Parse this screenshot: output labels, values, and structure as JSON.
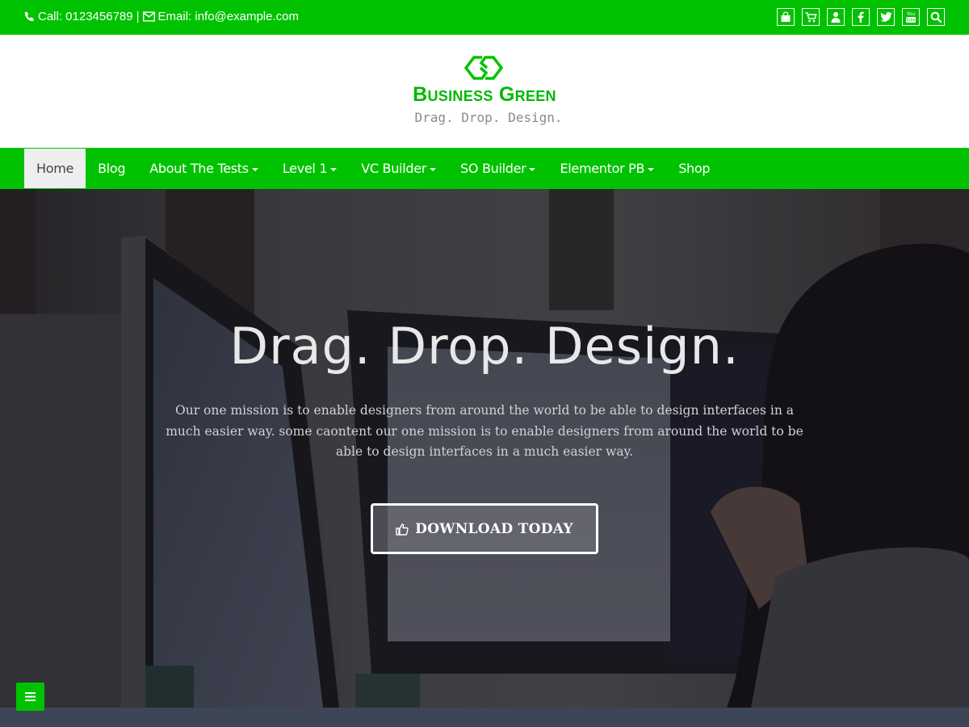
{
  "topbar": {
    "phone_icon": "phone-icon",
    "phone_text": "Call: 0123456789",
    "separator": "|",
    "email_icon": "envelope-icon",
    "email_text": "Email: info@example.com",
    "social_icons": [
      "shopping-bag-icon",
      "cart-icon",
      "user-icon",
      "facebook-icon",
      "twitter-icon",
      "youtube-icon",
      "search-icon"
    ]
  },
  "header": {
    "logo_icon": "business-green-logo-icon",
    "brand_name": "Business Green",
    "tagline": "Drag. Drop. Design."
  },
  "nav": {
    "items": [
      {
        "label": "Home",
        "active": true,
        "dropdown": false
      },
      {
        "label": "Blog",
        "active": false,
        "dropdown": false
      },
      {
        "label": "About The Tests",
        "active": false,
        "dropdown": true
      },
      {
        "label": "Level 1",
        "active": false,
        "dropdown": true
      },
      {
        "label": "VC Builder",
        "active": false,
        "dropdown": true
      },
      {
        "label": "SO Builder",
        "active": false,
        "dropdown": true
      },
      {
        "label": "Elementor PB",
        "active": false,
        "dropdown": true
      },
      {
        "label": "Shop",
        "active": false,
        "dropdown": false
      }
    ]
  },
  "hero": {
    "title": "Drag. Drop. Design.",
    "text": "Our one mission is to enable designers from around the world to be able to design interfaces in a much easier way. some caontent our one mission is to enable designers from around the world to be able to design interfaces in a much easier way.",
    "button_icon": "thumbs-up-icon",
    "button_label": "DOWNLOAD TODAY"
  },
  "fab": {
    "icon": "hamburger-menu-icon"
  },
  "colors": {
    "brand_green": "#00c200",
    "logo_green": "#00b800",
    "tagline_gray": "#8a8a8a",
    "active_nav_bg": "#eeeeee",
    "footer_bg": "#3d4656"
  }
}
